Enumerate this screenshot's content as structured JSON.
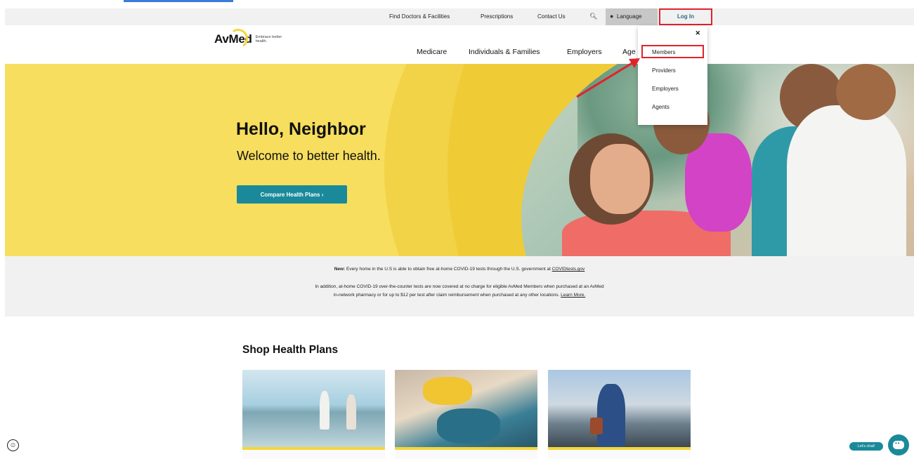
{
  "utility": {
    "links": [
      "Find Doctors & Facilities",
      "Prescriptions",
      "Contact Us"
    ],
    "search_icon": "search-icon",
    "language_label": "Language",
    "login_label": "Log In"
  },
  "header": {
    "logo_text": "AvMed",
    "logo_tagline": "Embrace better health.",
    "nav": [
      "Medicare",
      "Individuals & Families",
      "Employers",
      "Age"
    ]
  },
  "login_menu": {
    "close_icon": "close-icon",
    "items": [
      "Members",
      "Providers",
      "Employers",
      "Agents"
    ]
  },
  "hero": {
    "title": "Hello, Neighbor",
    "subtitle": "Welcome to better health.",
    "cta_label": "Compare Health Plans ›"
  },
  "notice": {
    "new_label": "New:",
    "line1": "Every home in the U.S is able to obtain free at-home COVID-19 tests through the U.S. government at",
    "line1_link": "COVIDtests.gov",
    "line2": "In addition, at-home COVID-19 over-the-counter tests are now covered at no charge for eligible AvMed Members when purchased at an AvMed",
    "line3": "in-network pharmacy or for up to $12 per test after claim reimbursement when purchased at any other locations.",
    "line3_link": "Learn More."
  },
  "shop": {
    "title": "Shop Health Plans"
  },
  "chat": {
    "label": "Let's chat!"
  },
  "colors": {
    "brand_yellow": "#f7de5e",
    "brand_teal": "#1a8a9a",
    "annotation_red": "#e0232a"
  }
}
